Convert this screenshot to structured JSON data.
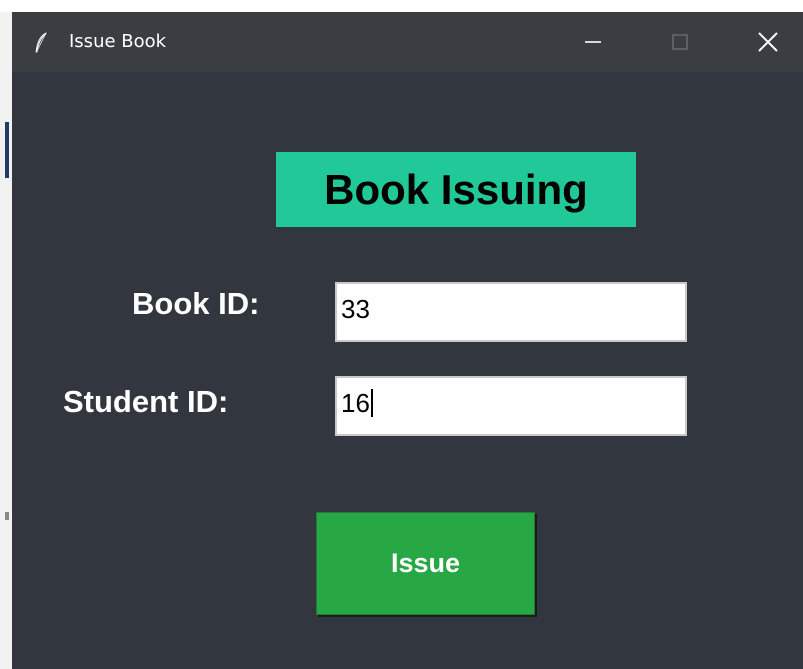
{
  "window": {
    "title": "Issue Book",
    "controls": {
      "minimize_icon": "minimize-icon",
      "maximize_icon": "maximize-icon",
      "close_icon": "close-icon"
    },
    "app_icon": "feather-icon"
  },
  "form": {
    "heading": "Book Issuing",
    "book_id_label": "Book ID:",
    "book_id_value": "33",
    "student_id_label": "Student ID:",
    "student_id_value": "16",
    "issue_button_label": "Issue"
  },
  "colors": {
    "heading_bg": "#20c997",
    "window_bg": "#32363e",
    "button_bg": "#28a745",
    "titlebar_bg": "#3a3d41"
  }
}
